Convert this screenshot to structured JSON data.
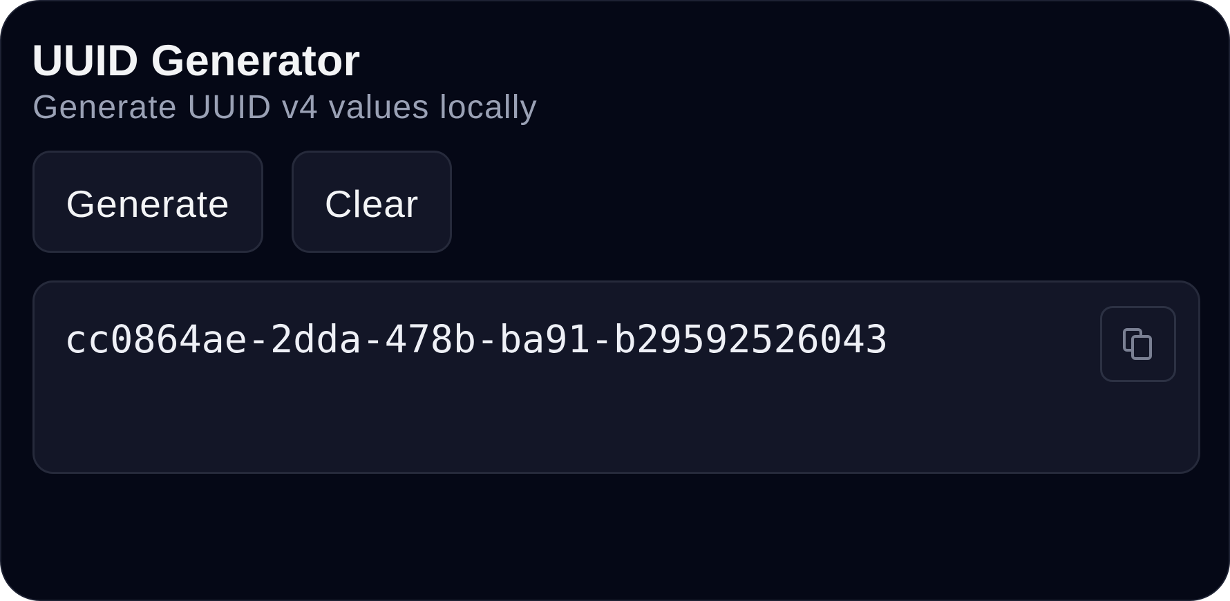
{
  "header": {
    "title": "UUID Generator",
    "subtitle": "Generate UUID v4 values locally"
  },
  "actions": {
    "generate_label": "Generate",
    "clear_label": "Clear"
  },
  "output": {
    "uuid": "cc0864ae-2dda-478b-ba91-b29592526043",
    "copy_icon": "copy-icon"
  },
  "colors": {
    "background": "#050816",
    "panel": "#131627",
    "border": "#262a3b",
    "text": "#f3f4f6",
    "muted_text": "#9aa1b5"
  }
}
